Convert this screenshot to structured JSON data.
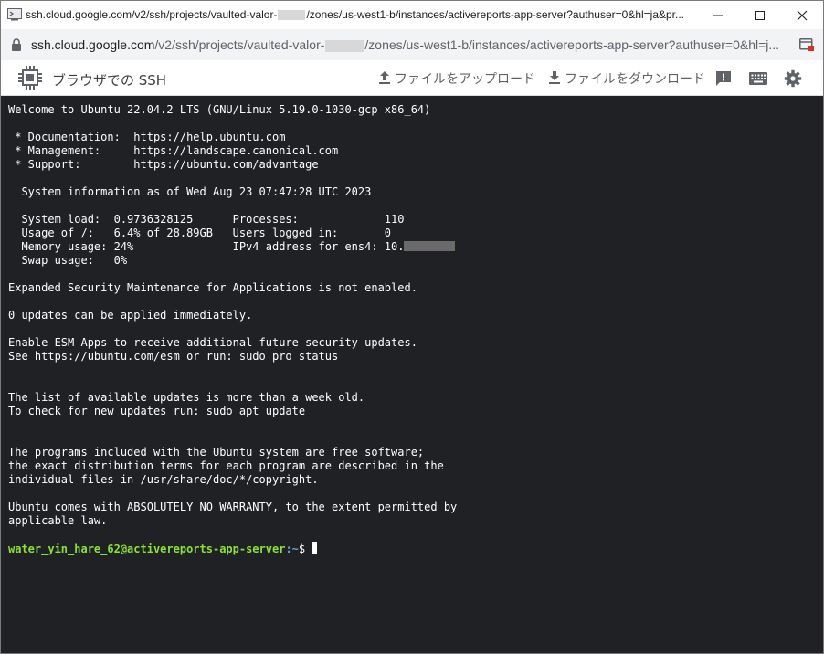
{
  "window": {
    "title_prefix": "ssh.cloud.google.com/v2/ssh/projects/vaulted-valor-",
    "title_suffix": "/zones/us-west1-b/instances/activereports-app-server?authuser=0&hl=ja&pr..."
  },
  "address_bar": {
    "url_host": "ssh.cloud.google.com",
    "url_path_prefix": "/v2/ssh/projects/vaulted-valor-",
    "url_path_suffix": "/zones/us-west1-b/instances/activereports-app-server?authuser=0&hl=j..."
  },
  "toolbar": {
    "app_title": "ブラウザでの SSH",
    "upload_label": "ファイルをアップロード",
    "download_label": "ファイルをダウンロード"
  },
  "terminal": {
    "lines": [
      "Welcome to Ubuntu 22.04.2 LTS (GNU/Linux 5.19.0-1030-gcp x86_64)",
      "",
      " * Documentation:  https://help.ubuntu.com",
      " * Management:     https://landscape.canonical.com",
      " * Support:        https://ubuntu.com/advantage",
      "",
      "  System information as of Wed Aug 23 07:47:28 UTC 2023",
      "",
      "  System load:  0.9736328125      Processes:             110",
      "  Usage of /:   6.4% of 28.89GB   Users logged in:       0",
      "  Memory usage: 24%               IPv4 address for ens4: 10.",
      "  Swap usage:   0%",
      "",
      "Expanded Security Maintenance for Applications is not enabled.",
      "",
      "0 updates can be applied immediately.",
      "",
      "Enable ESM Apps to receive additional future security updates.",
      "See https://ubuntu.com/esm or run: sudo pro status",
      "",
      "",
      "The list of available updates is more than a week old.",
      "To check for new updates run: sudo apt update",
      "",
      "",
      "The programs included with the Ubuntu system are free software;",
      "the exact distribution terms for each program are described in the",
      "individual files in /usr/share/doc/*/copyright.",
      "",
      "Ubuntu comes with ABSOLUTELY NO WARRANTY, to the extent permitted by",
      "applicable law.",
      ""
    ],
    "prompt_user": "water_yin_hare_62@activereports-app-server",
    "prompt_path": ":~",
    "prompt_symbol": "$ "
  },
  "colors": {
    "terminal_bg": "#202124",
    "prompt_user": "#8ae234",
    "prompt_path": "#729fcf"
  }
}
